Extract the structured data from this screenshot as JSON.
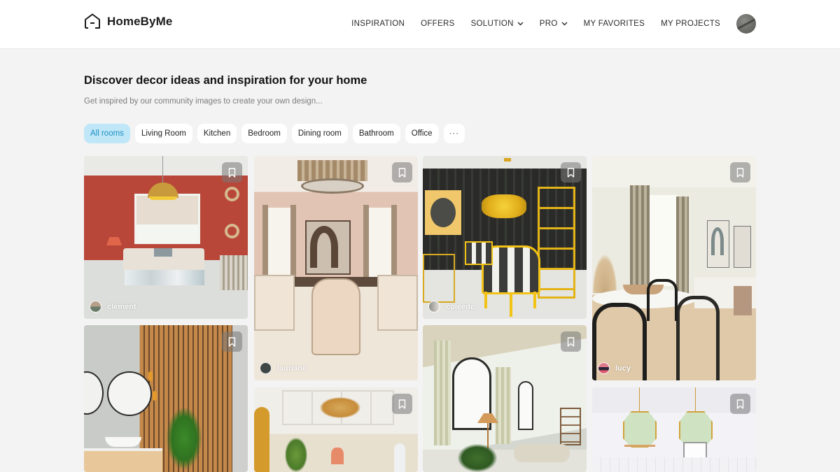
{
  "header": {
    "brand": "HomeByMe",
    "nav": [
      {
        "label": "INSPIRATION",
        "has_dropdown": false
      },
      {
        "label": "OFFERS",
        "has_dropdown": false
      },
      {
        "label": "SOLUTION",
        "has_dropdown": true
      },
      {
        "label": "PRO",
        "has_dropdown": true
      },
      {
        "label": "MY FAVORITES",
        "has_dropdown": false
      },
      {
        "label": "MY PROJECTS",
        "has_dropdown": false
      }
    ]
  },
  "hero": {
    "title": "Discover decor ideas and inspiration for your home",
    "subtitle": "Get inspired by our community images to create your own design..."
  },
  "filters": {
    "items": [
      "All rooms",
      "Living Room",
      "Kitchen",
      "Bedroom",
      "Dining room",
      "Bathroom",
      "Office"
    ],
    "active": "All rooms",
    "more_label": "···"
  },
  "colors": {
    "active_chip_bg": "#bfe7f7",
    "active_chip_text": "#1f8fc4",
    "page_bg": "#f3f3f3"
  },
  "gallery": {
    "cards": [
      {
        "scene": "red living room with gold pendant lamp",
        "username": "clement"
      },
      {
        "scene": "beige dining room with round chandelier",
        "username": "lauriane"
      },
      {
        "scene": "dark dining nook with yellow accents",
        "username": "coleede"
      },
      {
        "scene": "bright dining area with black chairs",
        "username": "lucy"
      },
      {
        "scene": "bathroom with wood slat wall and round mirrors",
        "username": ""
      },
      {
        "scene": "white room with coffered ceiling and rattan pendant",
        "username": ""
      },
      {
        "scene": "living room with arched windows",
        "username": ""
      },
      {
        "scene": "kitchen with green glass pendant lights",
        "username": ""
      }
    ]
  }
}
